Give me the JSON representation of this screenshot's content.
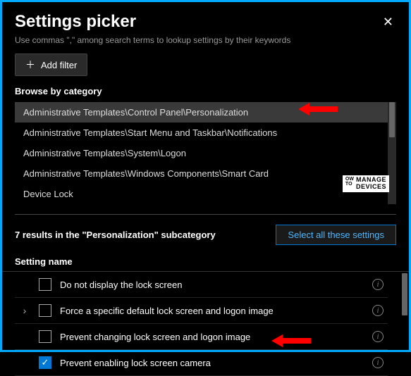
{
  "header": {
    "title": "Settings picker",
    "subtitle": "Use commas \",\" among search terms to lookup settings by their keywords"
  },
  "filter": {
    "add_label": "Add filter"
  },
  "browse": {
    "label": "Browse by category",
    "selected_index": 0,
    "categories": [
      "Administrative Templates\\Control Panel\\Personalization",
      "Administrative Templates\\Start Menu and Taskbar\\Notifications",
      "Administrative Templates\\System\\Logon",
      "Administrative Templates\\Windows Components\\Smart Card",
      "Device Lock"
    ]
  },
  "results": {
    "summary": "7 results in the \"Personalization\" subcategory",
    "select_all_label": "Select all these settings",
    "column_header": "Setting name",
    "settings": [
      {
        "label": "Do not display the lock screen",
        "checked": false,
        "expandable": false
      },
      {
        "label": "Force a specific default lock screen and logon image",
        "checked": false,
        "expandable": true
      },
      {
        "label": "Prevent changing lock screen and logon image",
        "checked": false,
        "expandable": false
      },
      {
        "label": "Prevent enabling lock screen camera",
        "checked": true,
        "expandable": false
      }
    ]
  },
  "annotations": {
    "arrow_color": "#ff0000"
  },
  "watermark": {
    "left_top": "OW",
    "left_bottom": "TO",
    "right_top": "MANAGE",
    "right_bottom": "DEVICES"
  }
}
